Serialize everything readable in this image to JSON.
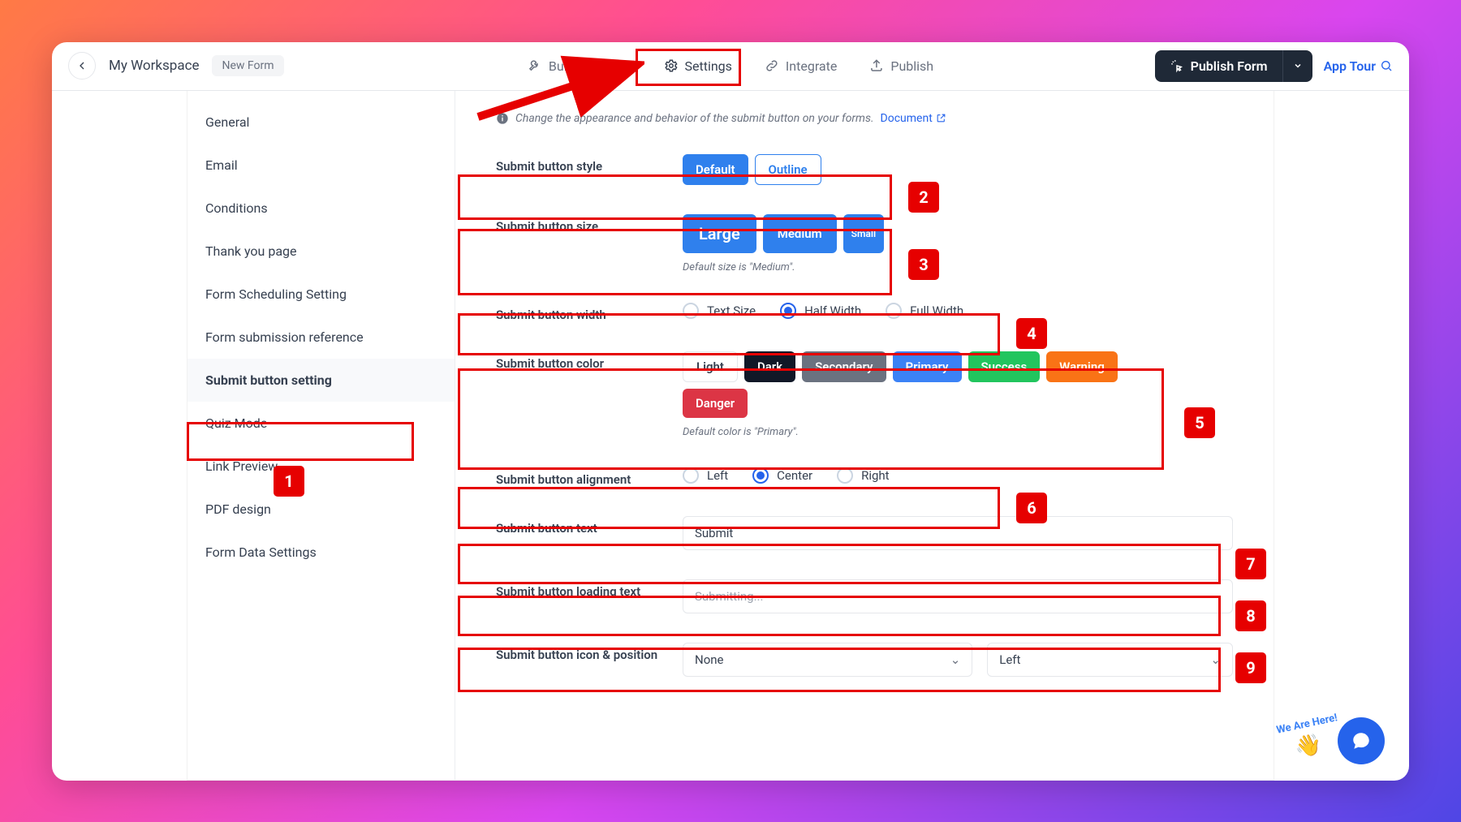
{
  "header": {
    "workspace": "My Workspace",
    "form_name": "New Form",
    "tabs": {
      "build": "Build",
      "design": "",
      "settings": "Settings",
      "integrate": "Integrate",
      "publish": "Publish"
    },
    "publish_button": "Publish Form",
    "app_tour": "App Tour"
  },
  "sidebar": {
    "items": [
      "General",
      "Email",
      "Conditions",
      "Thank you page",
      "Form Scheduling Setting",
      "Form submission reference",
      "Submit button setting",
      "Quiz Mode",
      "Link Preview",
      "PDF design",
      "Form Data Settings"
    ],
    "active_index": 6
  },
  "help": {
    "text": "Change the appearance and behavior of the submit button on your forms.",
    "link_label": "Document"
  },
  "settings": {
    "style": {
      "label": "Submit button style",
      "default": "Default",
      "outline": "Outline"
    },
    "size": {
      "label": "Submit button size",
      "large": "Large",
      "medium": "Medium",
      "small": "Small",
      "hint": "Default size is \"Medium\"."
    },
    "width": {
      "label": "Submit button width",
      "options": [
        "Text Size",
        "Half Width",
        "Full Width"
      ],
      "selected": 1
    },
    "color": {
      "label": "Submit button color",
      "options": [
        "Light",
        "Dark",
        "Secondary",
        "Primary",
        "Success",
        "Warning",
        "Danger"
      ],
      "hint": "Default color is \"Primary\"."
    },
    "alignment": {
      "label": "Submit button alignment",
      "options": [
        "Left",
        "Center",
        "Right"
      ],
      "selected": 1
    },
    "text": {
      "label": "Submit button text",
      "value": "Submit"
    },
    "loading": {
      "label": "Submit button loading text",
      "placeholder": "Submitting..."
    },
    "icon": {
      "label": "Submit button icon & position",
      "icon_value": "None",
      "pos_value": "Left"
    }
  },
  "annotations": [
    "1",
    "2",
    "3",
    "4",
    "5",
    "6",
    "7",
    "8",
    "9"
  ],
  "chat": {
    "label": "We Are Here!"
  }
}
